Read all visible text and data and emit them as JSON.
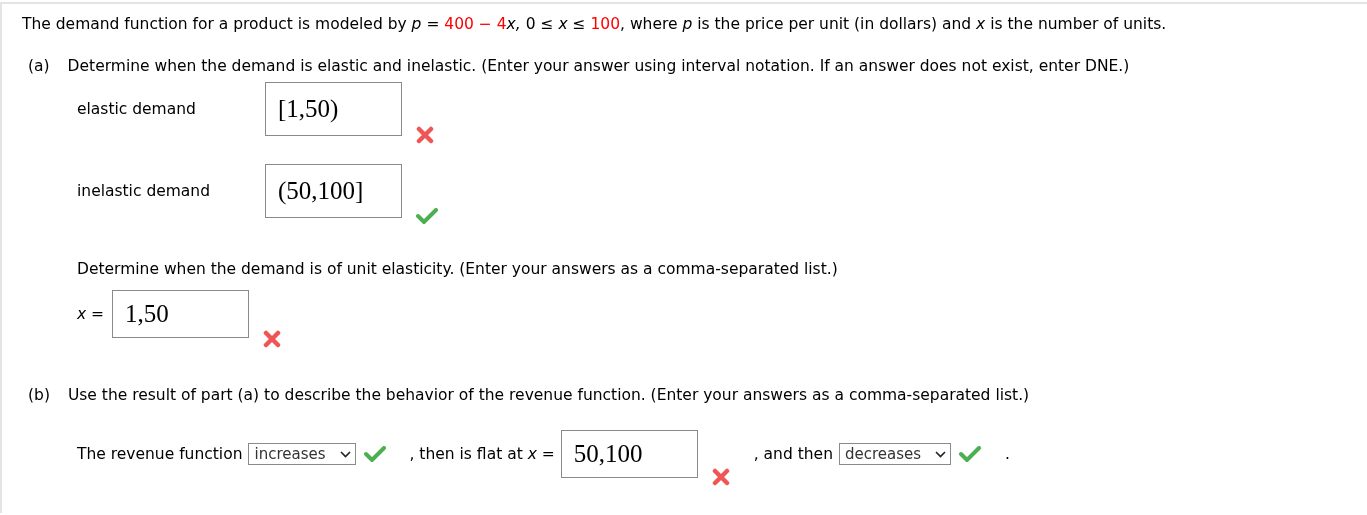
{
  "problem": {
    "segments": [
      {
        "kind": "plain",
        "text": "The demand function for a product is modeled by"
      },
      {
        "kind": "italic",
        "text": "p"
      },
      {
        "kind": "plain",
        "text": "="
      },
      {
        "kind": "red",
        "text": "400 − 4"
      },
      {
        "kind": "italic",
        "text": "x,"
      },
      {
        "kind": "plain",
        "text": "0 ≤"
      },
      {
        "kind": "italic",
        "text": "x"
      },
      {
        "kind": "plain",
        "text": "≤"
      },
      {
        "kind": "red",
        "text": "100"
      },
      {
        "kind": "plain",
        "text": ", where"
      },
      {
        "kind": "italic",
        "text": "p"
      },
      {
        "kind": "plain",
        "text": "is the price per unit (in dollars) and"
      },
      {
        "kind": "italic",
        "text": "x"
      },
      {
        "kind": "plain",
        "text": "is the number of units."
      }
    ]
  },
  "part_a": {
    "label": "(a)",
    "instruction": "Determine when the demand is elastic and inelastic. (Enter your answer using interval notation. If an answer does not exist, enter DNE.)",
    "answers": [
      {
        "label": "elastic demand",
        "value": "[1,50)",
        "correct": false
      },
      {
        "label": "inelastic demand",
        "value": "(50,100]",
        "correct": true
      }
    ],
    "unit_question": "Determine when the demand is of unit elasticity. (Enter your answers as a comma-separated list.)",
    "unit_answer": {
      "label": "*x* =",
      "value": "1,50",
      "correct": false
    }
  },
  "part_b": {
    "label": "(b)",
    "instruction": "Use the result of part (a) to describe the behavior of the revenue function. (Enter your answers as a comma-separated list.)",
    "sentence": [
      {
        "kind": "text",
        "text": "The revenue function"
      },
      {
        "kind": "select",
        "value": "increases",
        "correct": true
      },
      {
        "kind": "text",
        "text": ", then is flat at *x* ="
      },
      {
        "kind": "input",
        "value": "50,100",
        "correct": false
      },
      {
        "kind": "text",
        "text": ", and then"
      },
      {
        "kind": "select",
        "value": "decreases",
        "correct": true
      },
      {
        "kind": "text",
        "text": "."
      }
    ]
  }
}
